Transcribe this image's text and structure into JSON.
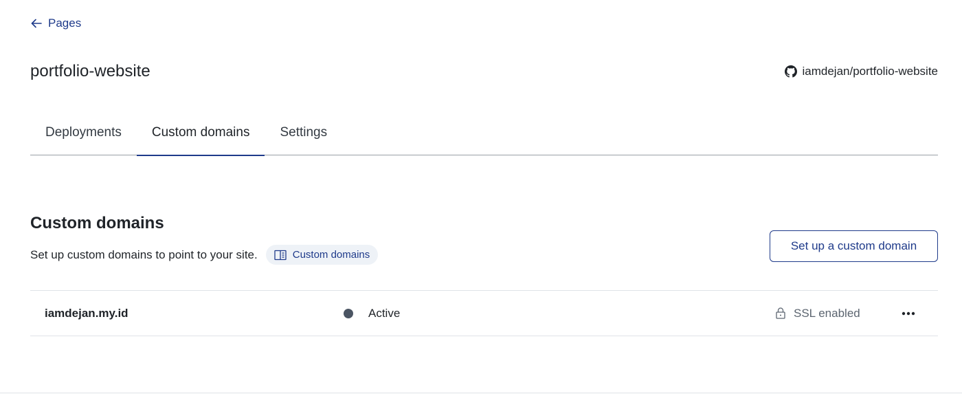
{
  "nav": {
    "back_label": "Pages",
    "back_icon": "arrow-left-icon"
  },
  "project": {
    "title": "portfolio-website",
    "repo": "iamdejan/portfolio-website",
    "repo_icon": "github-icon"
  },
  "tabs": [
    {
      "label": "Deployments",
      "active": false
    },
    {
      "label": "Custom domains",
      "active": true
    },
    {
      "label": "Settings",
      "active": false
    }
  ],
  "section": {
    "title": "Custom domains",
    "description": "Set up custom domains to point to your site.",
    "docs_label": "Custom domains",
    "docs_icon": "book-icon",
    "action_label": "Set up a custom domain"
  },
  "domains": [
    {
      "name": "iamdejan.my.id",
      "status": "Active",
      "ssl": "SSL enabled",
      "ssl_icon": "lock-icon",
      "more_icon": "more-horizontal-icon"
    }
  ],
  "colors": {
    "accent": "#1e3a8a",
    "status_dot": "#4b5563",
    "divider": "#dfe3e8",
    "pill_bg": "#eef2f7"
  }
}
